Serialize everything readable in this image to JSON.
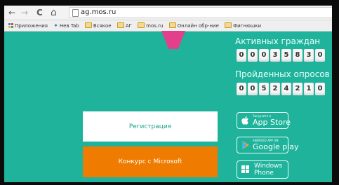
{
  "browser": {
    "back_glyph": "←",
    "forward_glyph": "→",
    "reload_glyph": "C",
    "home_glyph": "⌂",
    "url": "ag.mos.ru"
  },
  "bookmarks": [
    {
      "label": "Приложения",
      "icon": "apps-grid-icon"
    },
    {
      "label": "Нев Tab",
      "icon": "bookmark-star-icon"
    },
    {
      "label": "Всякое",
      "icon": "folder-icon"
    },
    {
      "label": "АГ",
      "icon": "folder-icon"
    },
    {
      "label": "mos.ru",
      "icon": "folder-icon"
    },
    {
      "label": "Онлайн обр-ние",
      "icon": "folder-icon"
    },
    {
      "label": "Фигнюшки",
      "icon": "folder-icon"
    }
  ],
  "counters": {
    "active_title": "Активных граждан",
    "active_digits": [
      "0",
      "0",
      "0",
      "3",
      "5",
      "8",
      "3",
      "0"
    ],
    "polls_title": "Пройденных опросов",
    "polls_digits": [
      "0",
      "0",
      "5",
      "2",
      "4",
      "2",
      "1",
      "0"
    ]
  },
  "buttons": {
    "register": "Регистрация",
    "contest": "Конкурс с Microsoft"
  },
  "stores": {
    "appstore_small": "Загрузите в",
    "appstore_big": "App Store",
    "googleplay_small": "ANDROID APP ON",
    "googleplay_big": "Google play",
    "windows_big": "Windows Phone"
  },
  "colors": {
    "page_bg": "#1fb39b",
    "accent_orange": "#ef7b00",
    "accent_pink": "#e43f8a"
  }
}
